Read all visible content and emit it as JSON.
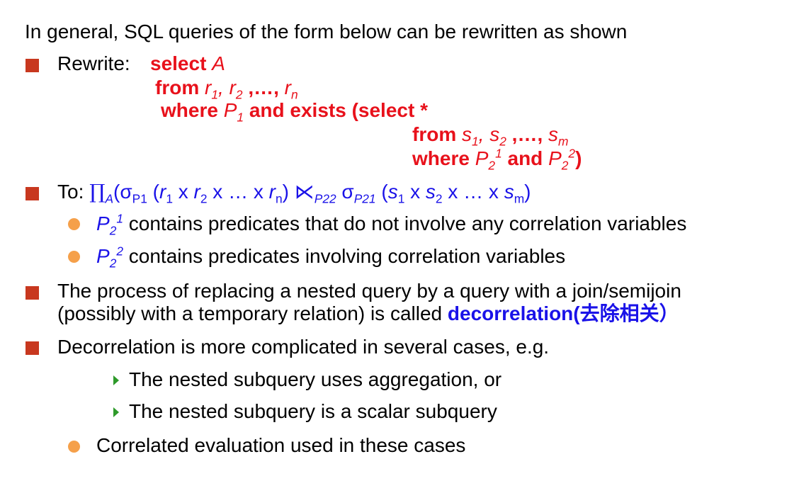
{
  "intro": "In general, SQL queries of the form below can be rewritten as shown",
  "rewrite": {
    "label": "Rewrite:",
    "select_kw": "select",
    "select_attr": "A",
    "from_kw": "from",
    "from_list": {
      "r": "r",
      "sub1": "1",
      "sub2": "2",
      "dots": ",…,",
      "subn": "n"
    },
    "where_kw": "where",
    "p1": "P",
    "p1_sub": "1",
    "and_exists": "and exists (select *",
    "inner_from_kw": "from",
    "inner_from_list": {
      "s": "s",
      "sub1": "1",
      "sub2": "2",
      "dots": ",…,",
      "subm": "m"
    },
    "inner_where_kw": "where",
    "p2": "P",
    "p2_sub": "2",
    "p2_sup1": "1",
    "and_kw": "and",
    "p2_sup2": "2",
    "close": ")"
  },
  "to": {
    "label": "To:",
    "pi": "∏",
    "a": "A",
    "sigma": "σ",
    "p1sub": "P1",
    "cross": "x",
    "ellipsis": "…",
    "semijoin": "⋉",
    "p22": "P22",
    "p21": "P21"
  },
  "points": {
    "p21_text": "contains predicates that do not involve any correlation variables",
    "p22_text": "contains predicates involving correlation variables",
    "decor_line1": "The process of replacing a nested query by a query with a join/semijoin",
    "decor_line2": "(possibly with a temporary relation) is called",
    "decor_term": "decorrelation(去除相关）",
    "complicated": "Decorrelation is more complicated in several cases, e.g.",
    "case1": "The nested subquery uses aggregation, or",
    "case2": "The nested subquery is a scalar subquery",
    "correlated": "Correlated evaluation used in these cases"
  },
  "colors": {
    "red_keyword": "#e8111b",
    "blue_text": "#1a12e8",
    "square_bullet": "#c8381f",
    "dot_bullet": "#f5a04a",
    "arrow_bullet": "#2e9a2a"
  }
}
